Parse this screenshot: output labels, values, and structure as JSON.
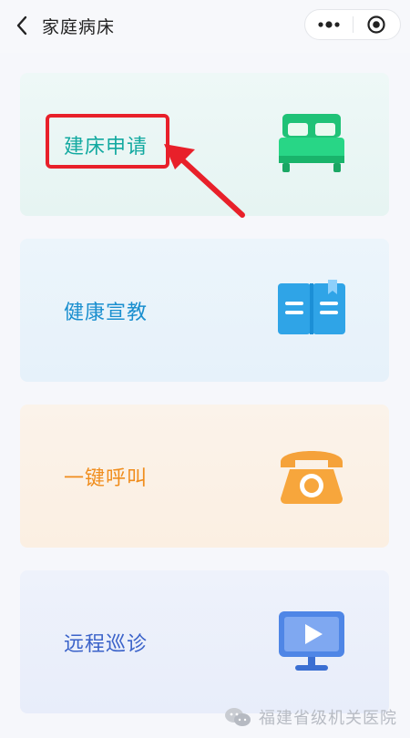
{
  "header": {
    "title": "家庭病床"
  },
  "cards": [
    {
      "label": "建床申请",
      "icon": "bed-icon"
    },
    {
      "label": "健康宣教",
      "icon": "book-icon"
    },
    {
      "label": "一键呼叫",
      "icon": "phone-icon"
    },
    {
      "label": "远程巡诊",
      "icon": "monitor-play-icon"
    }
  ],
  "watermark": {
    "text": "福建省级机关医院"
  },
  "colors": {
    "card1_text": "#12a9a0",
    "card2_text": "#1a8fcf",
    "card3_text": "#f08d1d",
    "card4_text": "#3a62c9",
    "highlight": "#e8202a"
  }
}
